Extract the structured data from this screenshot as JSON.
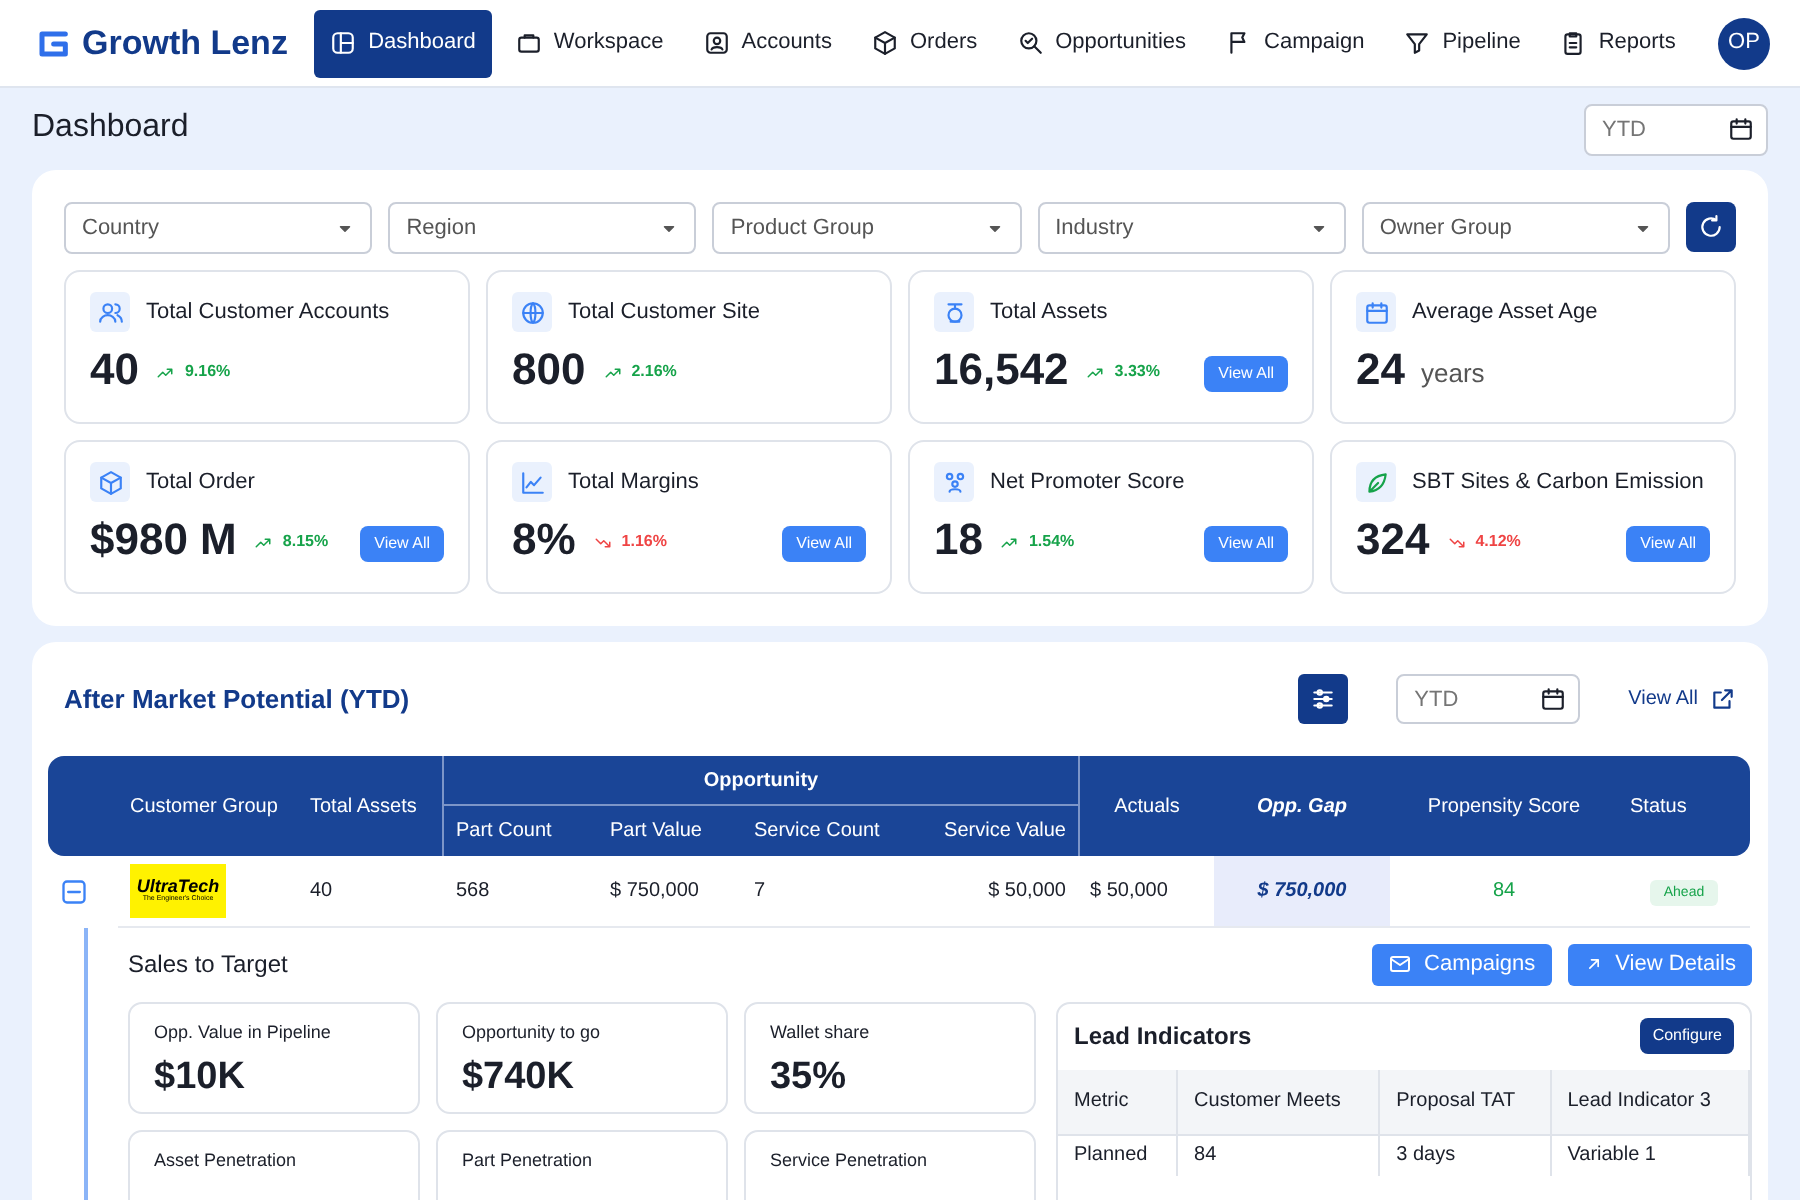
{
  "brand": {
    "name": "Growth Lenz"
  },
  "nav": [
    {
      "label": "Dashboard",
      "selected": true
    },
    {
      "label": "Workspace",
      "selected": false
    },
    {
      "label": "Accounts",
      "selected": false
    },
    {
      "label": "Orders",
      "selected": false
    },
    {
      "label": "Opportunities",
      "selected": false
    },
    {
      "label": "Campaign",
      "selected": false
    },
    {
      "label": "Pipeline",
      "selected": false
    },
    {
      "label": "Reports",
      "selected": false
    }
  ],
  "user": {
    "initials": "OP"
  },
  "page": {
    "title": "Dashboard",
    "period_placeholder": "YTD"
  },
  "filters": [
    {
      "placeholder": "Country"
    },
    {
      "placeholder": "Region"
    },
    {
      "placeholder": "Product Group"
    },
    {
      "placeholder": "Industry"
    },
    {
      "placeholder": "Owner Group"
    }
  ],
  "kpis": [
    {
      "title": "Total Customer Accounts",
      "value": "40",
      "trend": {
        "kind": "up",
        "text": "9.16%"
      }
    },
    {
      "title": "Total Customer Site",
      "value": "800",
      "trend": {
        "kind": "up",
        "text": "2.16%"
      }
    },
    {
      "title": "Total Assets",
      "value": "16,542",
      "trend": {
        "kind": "up",
        "text": "3.33%"
      },
      "button": "View All"
    },
    {
      "title": "Average Asset Age",
      "value": "24",
      "unit": "years"
    },
    {
      "title": "Total Order",
      "value": "$980 M",
      "trend": {
        "kind": "up",
        "text": "8.15%"
      },
      "button": "View All"
    },
    {
      "title": "Total Margins",
      "value": "8%",
      "trend": {
        "kind": "down",
        "text": "1.16%"
      },
      "button": "View All"
    },
    {
      "title": "Net Promoter Score",
      "value": "18",
      "trend": {
        "kind": "up",
        "text": "1.54%"
      },
      "button": "View All"
    },
    {
      "title": "SBT Sites & Carbon Emission",
      "value": "324",
      "trend": {
        "kind": "down",
        "text": "4.12%"
      },
      "button": "View All"
    }
  ],
  "potential": {
    "title": "After Market Potential (YTD)",
    "period_placeholder": "YTD",
    "view_all": "View All",
    "columns": {
      "customer_group": "Customer Group",
      "total_assets": "Total Assets",
      "opportunity": "Opportunity",
      "opportunity_sub": [
        "Part Count",
        "Part Value",
        "Service Count",
        "Service Value"
      ],
      "actuals": "Actuals",
      "opp_gap": "Opp. Gap",
      "propensity": "Propensity Score",
      "status": "Status"
    },
    "rows": [
      {
        "expanded": true,
        "logo": {
          "name": "UltraTech",
          "tagline": "The Engineer's Choice"
        },
        "total_assets": "40",
        "part_count": "568",
        "part_value": "$ 750,000",
        "service_count": "7",
        "service_value": "$ 50,000",
        "actuals": "$ 50,000",
        "opp_gap": "$ 750,000",
        "propensity": "84",
        "status": {
          "kind": "ahead",
          "text": "Ahead"
        }
      }
    ],
    "detail": {
      "title": "Sales to Target",
      "buttons": [
        "Campaigns",
        "View Details"
      ],
      "metrics": [
        {
          "label": "Opp. Value in Pipeline",
          "value": "$10K"
        },
        {
          "label": "Opportunity to go",
          "value": "$740K"
        },
        {
          "label": "Wallet share",
          "value": "35%"
        },
        {
          "label": "Asset Penetration"
        },
        {
          "label": "Part Penetration"
        },
        {
          "label": "Service Penetration"
        }
      ],
      "lead": {
        "title": "Lead Indicators",
        "button": "Configure",
        "columns": [
          "Metric",
          "Customer Meets",
          "Proposal TAT",
          "Lead Indicator 3"
        ],
        "rows": [
          [
            "Planned",
            "84",
            "3 days",
            "Variable 1"
          ]
        ]
      }
    }
  }
}
